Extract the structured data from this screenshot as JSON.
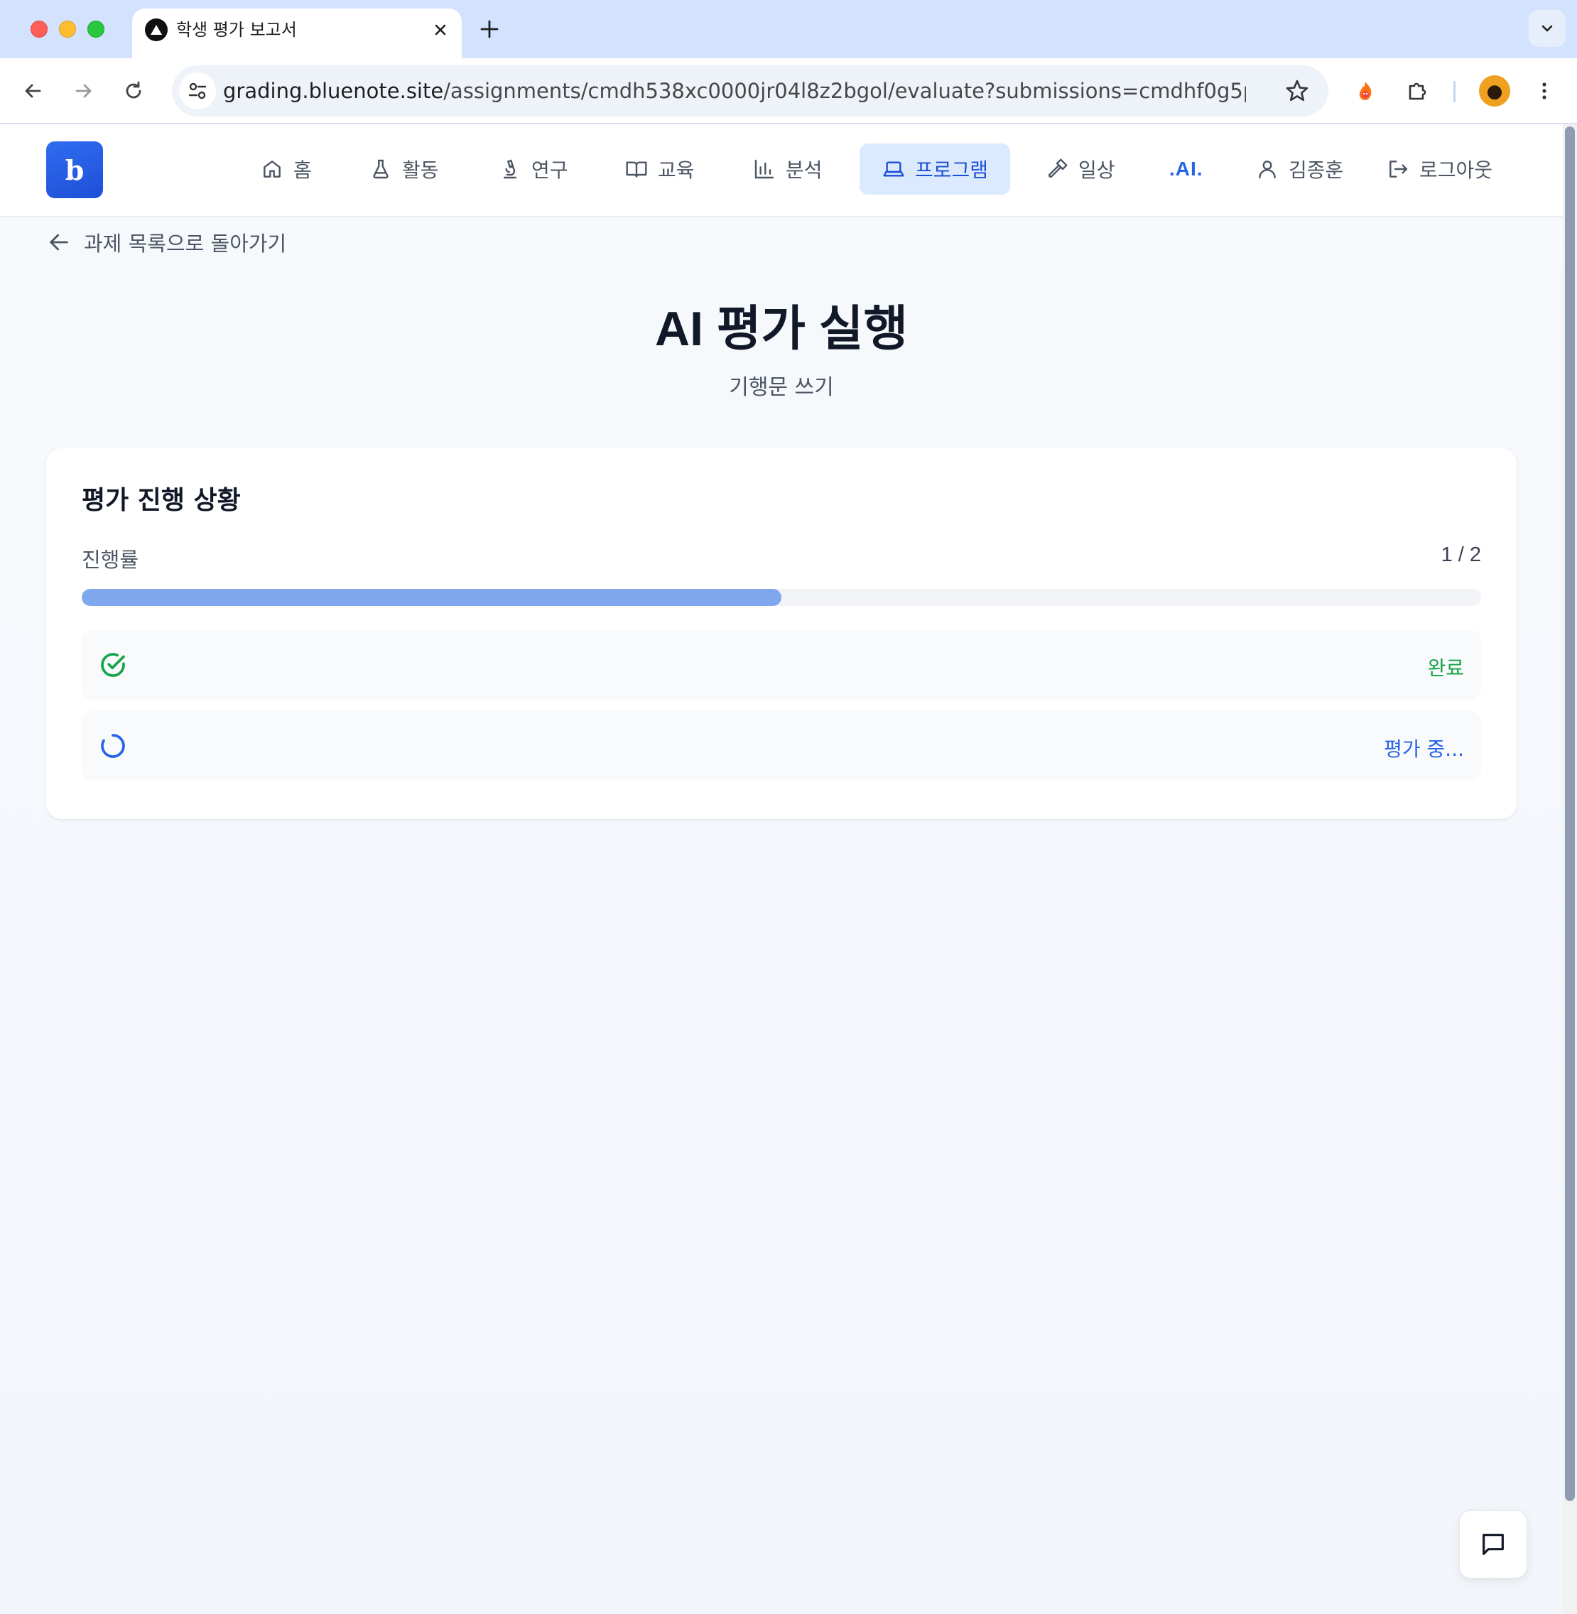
{
  "browser": {
    "tab_title": "학생 평가 보고서",
    "url_host": "grading.bluenote.site",
    "url_path": "/assignments/cmdh538xc0000jr04l8z2bgol/evaluate?submissions=cmdhf0g5p0003if0..."
  },
  "header": {
    "logo_text": "b",
    "nav": [
      {
        "label": "홈",
        "icon": "home-icon"
      },
      {
        "label": "활동",
        "icon": "flask-icon"
      },
      {
        "label": "연구",
        "icon": "microscope-icon"
      },
      {
        "label": "교육",
        "icon": "book-open-icon"
      },
      {
        "label": "분석",
        "icon": "bar-chart-icon"
      },
      {
        "label": "프로그램",
        "icon": "laptop-icon",
        "active": true
      },
      {
        "label": "일상",
        "icon": "hammer-icon"
      },
      {
        "label": ".AI."
      },
      {
        "label": "김종훈",
        "icon": "user-icon"
      },
      {
        "label": "로그아웃",
        "icon": "logout-icon"
      }
    ]
  },
  "back_link": "과제 목록으로 돌아가기",
  "page_title": "AI 평가 실행",
  "page_subtitle": "기행문 쓰기",
  "progress_card": {
    "title": "평가 진행 상황",
    "progress_label": "진행률",
    "progress_count": "1 / 2",
    "progress_fraction": 0.5,
    "items": [
      {
        "status": "완료",
        "state": "done",
        "color": "#16a34a"
      },
      {
        "status": "평가 중...",
        "state": "in-progress",
        "color": "#2563eb"
      }
    ]
  },
  "colors": {
    "accent": "#2563eb",
    "active_nav_bg": "#dbeafe",
    "progress_fill": "#7ea7ee",
    "success": "#16a34a"
  }
}
